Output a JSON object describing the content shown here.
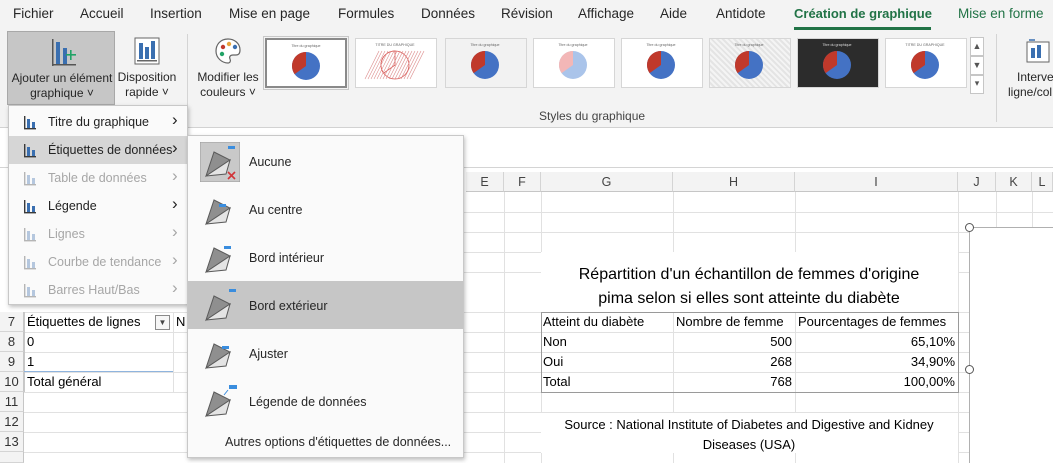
{
  "ribbon": {
    "tabs": [
      "Fichier",
      "Accueil",
      "Insertion",
      "Mise en page",
      "Formules",
      "Données",
      "Révision",
      "Affichage",
      "Aide",
      "Antidote",
      "Création de graphique",
      "Mise en forme"
    ],
    "active_tab": "Création de graphique",
    "buttons": {
      "add_element_line1": "Ajouter un élément",
      "add_element_line2": "graphique",
      "quick_layout_line1": "Disposition",
      "quick_layout_line2": "rapide",
      "change_colors_line1": "Modifier les",
      "change_colors_line2": "couleurs",
      "switch_line1": "Interve",
      "switch_line2": "ligne/col"
    },
    "styles_group_label": "Styles du graphique",
    "style_thumbs": [
      {
        "title": "Titre du graphique",
        "variant": "selected"
      },
      {
        "title": "TITRE DU GRAPHIQUE",
        "variant": "striped-light"
      },
      {
        "title": "Titre du graphique",
        "variant": "grey"
      },
      {
        "title": "Titre du graphique",
        "variant": "light"
      },
      {
        "title": "Titre du graphique",
        "variant": "plain"
      },
      {
        "title": "Titre du graphique",
        "variant": "striped"
      },
      {
        "title": "Titre du graphique",
        "variant": "dark"
      },
      {
        "title": "TITRE DU GRAPHIQUE",
        "variant": "plain"
      }
    ]
  },
  "menu_chart_element": {
    "items": [
      {
        "label": "Titre du graphique",
        "enabled": true,
        "submenu": true,
        "hover": false
      },
      {
        "label": "Étiquettes de données",
        "enabled": true,
        "submenu": true,
        "hover": true
      },
      {
        "label": "Table de données",
        "enabled": false,
        "submenu": true,
        "hover": false
      },
      {
        "label": "Légende",
        "enabled": true,
        "submenu": true,
        "hover": false
      },
      {
        "label": "Lignes",
        "enabled": false,
        "submenu": true,
        "hover": false
      },
      {
        "label": "Courbe de tendance",
        "enabled": false,
        "submenu": true,
        "hover": false
      },
      {
        "label": "Barres Haut/Bas",
        "enabled": false,
        "submenu": true,
        "hover": false
      }
    ]
  },
  "menu_data_labels": {
    "items": [
      {
        "label": "Aucune",
        "hover": false
      },
      {
        "label": "Au centre",
        "hover": false
      },
      {
        "label": "Bord intérieur",
        "hover": false
      },
      {
        "label": "Bord extérieur",
        "hover": true
      },
      {
        "label": "Ajuster",
        "hover": false
      },
      {
        "label": "Légende de données",
        "hover": false
      }
    ],
    "more_options": "Autres options d'étiquettes de données..."
  },
  "sheet": {
    "columns": [
      "E",
      "F",
      "G",
      "H",
      "I",
      "J",
      "K",
      "L"
    ],
    "rows": [
      "7",
      "8",
      "9",
      "10",
      "11",
      "12",
      "13"
    ],
    "pivot": {
      "header_label": "Étiquettes de lignes",
      "header_col2_fragment": "N",
      "rows": [
        "0",
        "1",
        "Total général"
      ]
    },
    "table_title_line1": "Répartition d'un échantillon de femmes d'origine",
    "table_title_line2": "pima selon si elles sont atteinte du diabète",
    "table_headers": [
      "Atteint du diabète",
      "Nombre de femme",
      "Pourcentages de femmes"
    ],
    "table_rows": [
      [
        "Non",
        "500",
        "65,10%"
      ],
      [
        "Oui",
        "268",
        "34,90%"
      ],
      [
        "Total",
        "768",
        "100,00%"
      ]
    ],
    "source_line1": "Source : National Institute of Diabetes and Digestive and Kidney",
    "source_line2": "Diseases (USA)"
  },
  "colors": {
    "accent": "#217346",
    "pie_blue": "#4472c4",
    "pie_red": "#c0392b"
  }
}
